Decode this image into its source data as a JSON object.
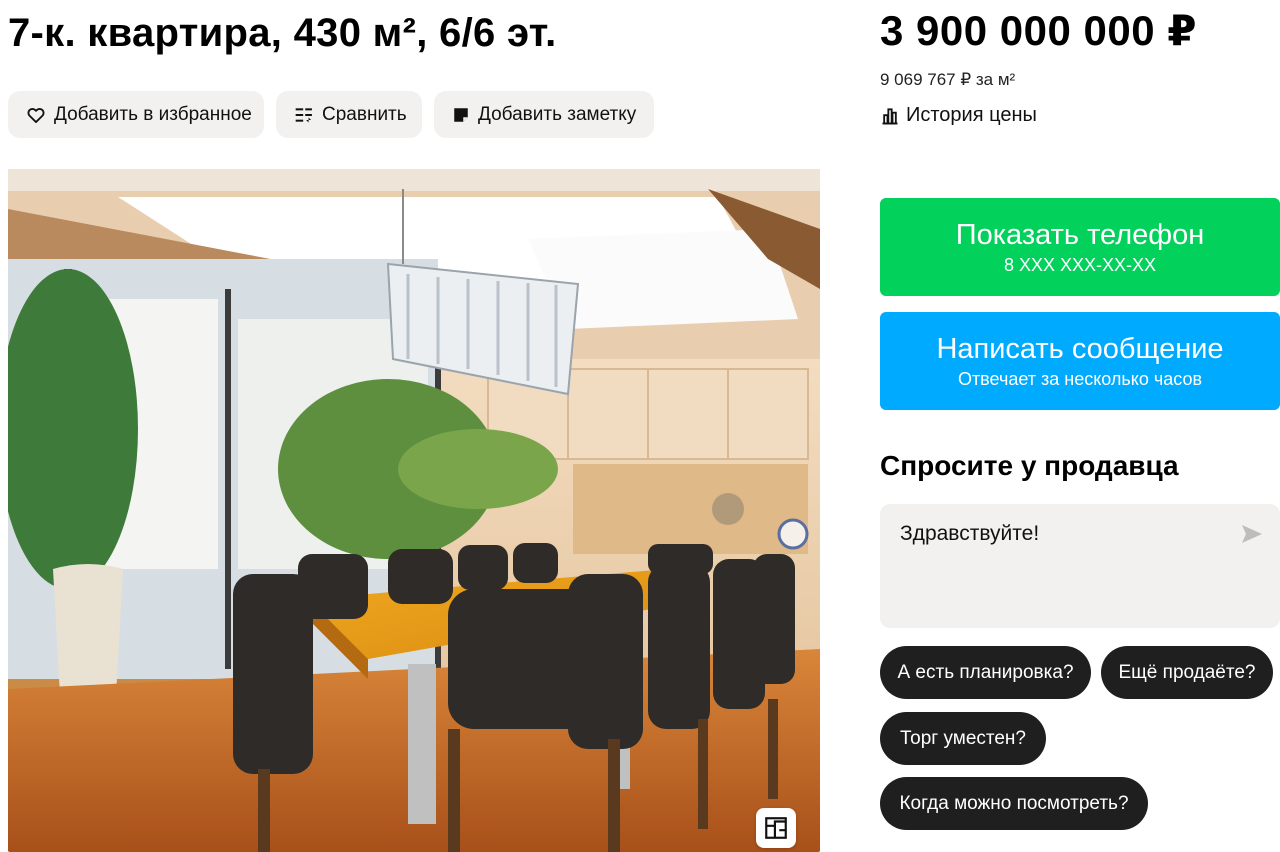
{
  "listing": {
    "title": "7-к. квартира, 430 м², 6/6 эт.",
    "actions": {
      "favorite": "Добавить в избранное",
      "compare": "Сравнить",
      "note": "Добавить заметку"
    }
  },
  "price": {
    "total": "3 900 000 000 ₽",
    "per_m2": "9 069 767 ₽ за м²",
    "history": "История цены"
  },
  "contact": {
    "phone_label": "Показать телефон",
    "phone_value": "8 XXX XXX-XX-XX",
    "message_label": "Написать сообщение",
    "message_sub": "Отвечает за несколько часов"
  },
  "ask": {
    "title": "Спросите у продавца",
    "message": "Здравствуйте!",
    "chips": [
      "А есть планировка?",
      "Ещё продаёте?",
      "Торг уместен?",
      "Когда можно посмотреть?"
    ]
  },
  "colors": {
    "green": "#02d15c",
    "blue": "#00aaff",
    "chip": "#1f1f1f",
    "light_bg": "#f2f1f0"
  },
  "icons": [
    "heart-icon",
    "compare-icon",
    "note-icon",
    "chart-icon",
    "send-icon",
    "floor-plan-icon"
  ]
}
